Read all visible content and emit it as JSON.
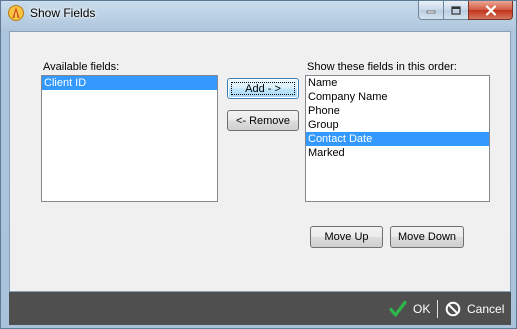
{
  "window": {
    "title": "Show Fields"
  },
  "available": {
    "label": "Available fields:",
    "items": [
      "Client ID"
    ],
    "selected_index": 0
  },
  "shown": {
    "label": "Show these fields in this order:",
    "items": [
      "Name",
      "Company Name",
      "Phone",
      "Group",
      "Contact Date",
      "Marked"
    ],
    "selected_index": 4
  },
  "buttons": {
    "add": "Add - >",
    "remove": "<- Remove",
    "move_up": "Move Up",
    "move_down": "Move Down"
  },
  "footer": {
    "ok": "OK",
    "cancel": "Cancel"
  },
  "colors": {
    "selection": "#3399ff",
    "footer_bg": "#4f4f4f",
    "ok_check": "#2fb64a"
  },
  "icons": {
    "app": "flame-app-icon",
    "minimize": "minimize-icon",
    "maximize": "maximize-icon",
    "close": "close-icon",
    "ok": "checkmark-icon",
    "cancel": "cancel-circle-icon"
  }
}
